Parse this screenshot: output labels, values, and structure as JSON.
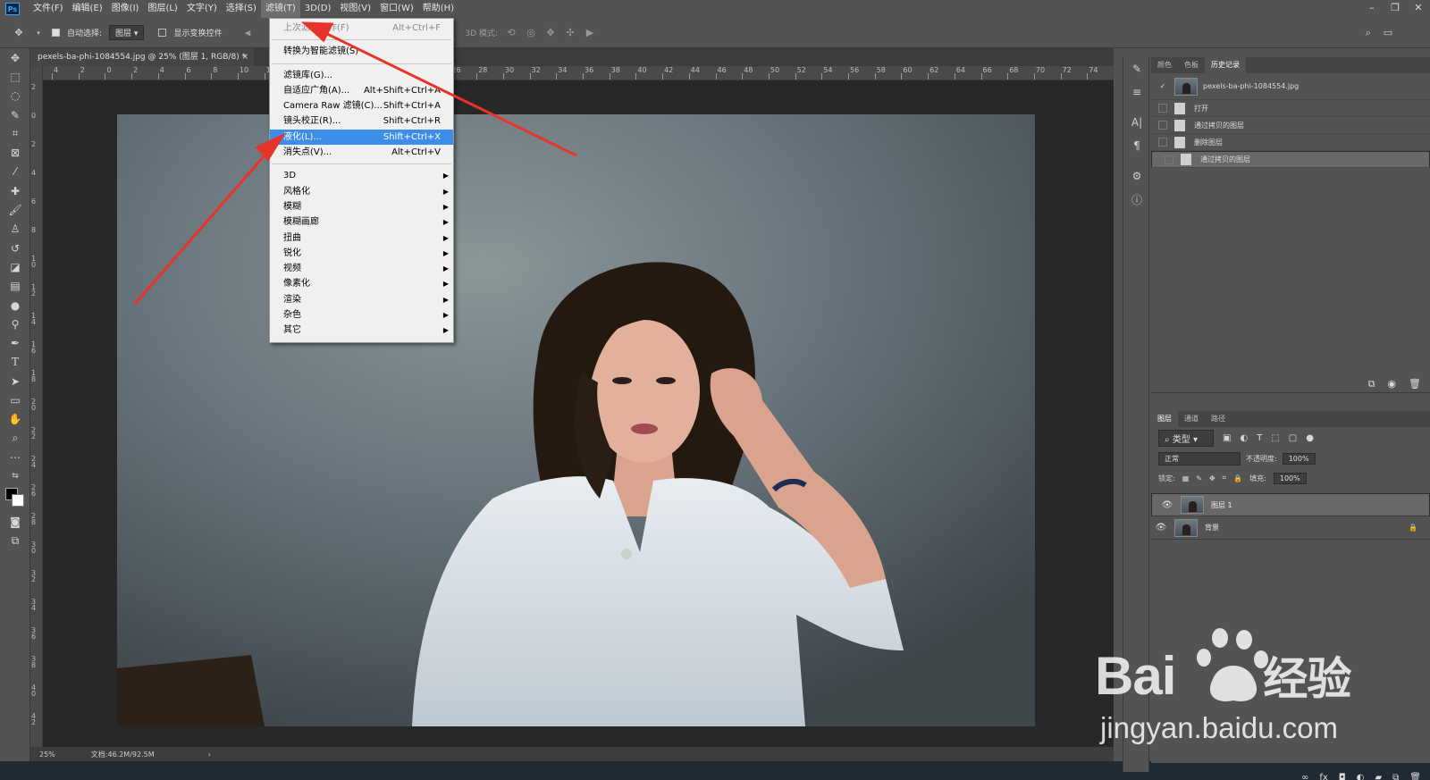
{
  "app": {
    "logo": "Ps"
  },
  "menubar": {
    "items": [
      "文件(F)",
      "编辑(E)",
      "图像(I)",
      "图层(L)",
      "文字(Y)",
      "选择(S)",
      "滤镜(T)",
      "3D(D)",
      "视图(V)",
      "窗口(W)",
      "帮助(H)"
    ],
    "active_index": 6,
    "window_controls": [
      "–",
      "❐",
      "✕"
    ]
  },
  "options_bar": {
    "auto_select_label": "自动选择:",
    "auto_select_value": "图层",
    "show_transform_label": "显示变换控件",
    "mode_3d_label": "3D 模式:"
  },
  "document": {
    "tab_title": "pexels-ba-phi-1084554.jpg @ 25% (图层 1, RGB/8) *",
    "close_glyph": "×"
  },
  "ruler": {
    "h_ticks": [
      "4",
      "2",
      "0",
      "2",
      "4",
      "6",
      "8",
      "10",
      "12",
      "14",
      "16",
      "18",
      "20",
      "22",
      "24",
      "26",
      "28",
      "30",
      "32",
      "34",
      "36",
      "38",
      "40",
      "42",
      "44",
      "46",
      "48",
      "50",
      "52",
      "54",
      "56",
      "58",
      "60",
      "62",
      "64",
      "66",
      "68",
      "70",
      "72",
      "74"
    ],
    "v_ticks": [
      "2",
      "0",
      "2",
      "4",
      "6",
      "8",
      "1 0",
      "1 2",
      "1 4",
      "1 6",
      "1 8",
      "2 0",
      "2 2",
      "2 4",
      "2 6",
      "2 8",
      "3 0",
      "3 2",
      "3 4",
      "3 6",
      "3 8",
      "4 0",
      "4 2"
    ]
  },
  "status_bar": {
    "zoom": "25%",
    "doc_size": "文档:46.2M/92.5M"
  },
  "filter_menu": {
    "groups": [
      [
        {
          "label": "上次滤镜操作(F)",
          "shortcut": "Alt+Ctrl+F",
          "disabled": true
        }
      ],
      [
        {
          "label": "转换为智能滤镜(S)",
          "shortcut": ""
        }
      ],
      [
        {
          "label": "滤镜库(G)...",
          "shortcut": ""
        },
        {
          "label": "自适应广角(A)...",
          "shortcut": "Alt+Shift+Ctrl+A"
        },
        {
          "label": "Camera Raw 滤镜(C)...",
          "shortcut": "Shift+Ctrl+A"
        },
        {
          "label": "镜头校正(R)...",
          "shortcut": "Shift+Ctrl+R"
        },
        {
          "label": "液化(L)...",
          "shortcut": "Shift+Ctrl+X",
          "highlighted": true
        },
        {
          "label": "消失点(V)...",
          "shortcut": "Alt+Ctrl+V"
        }
      ],
      [
        {
          "label": "3D",
          "submenu": true
        },
        {
          "label": "风格化",
          "submenu": true
        },
        {
          "label": "模糊",
          "submenu": true
        },
        {
          "label": "模糊画廊",
          "submenu": true
        },
        {
          "label": "扭曲",
          "submenu": true
        },
        {
          "label": "锐化",
          "submenu": true
        },
        {
          "label": "视频",
          "submenu": true
        },
        {
          "label": "像素化",
          "submenu": true
        },
        {
          "label": "渲染",
          "submenu": true
        },
        {
          "label": "杂色",
          "submenu": true
        },
        {
          "label": "其它",
          "submenu": true
        }
      ]
    ]
  },
  "history_panel": {
    "tabs": [
      "颜色",
      "色板",
      "历史记录"
    ],
    "active_tab": 2,
    "snapshot_name": "pexels-ba-phi-1084554.jpg",
    "items": [
      "打开",
      "通过拷贝的图层",
      "删除图层",
      "通过拷贝的图层"
    ],
    "selected_index": 3
  },
  "layers_panel": {
    "tabs": [
      "图层",
      "通道",
      "路径"
    ],
    "active_tab": 0,
    "filter_label": "类型",
    "blend_mode": "正常",
    "opacity_label": "不透明度:",
    "opacity_value": "100%",
    "lock_label": "锁定:",
    "fill_label": "填充:",
    "fill_value": "100%",
    "layers": [
      {
        "name": "图层 1",
        "selected": true,
        "locked": false
      },
      {
        "name": "背景",
        "selected": false,
        "locked": true
      }
    ]
  },
  "watermark": {
    "brand": "Bai",
    "brand_cn": "经验",
    "url": "jingyan.baidu.com"
  },
  "colors": {
    "accent": "#3d8ee8",
    "arrow": "#e8332b"
  }
}
